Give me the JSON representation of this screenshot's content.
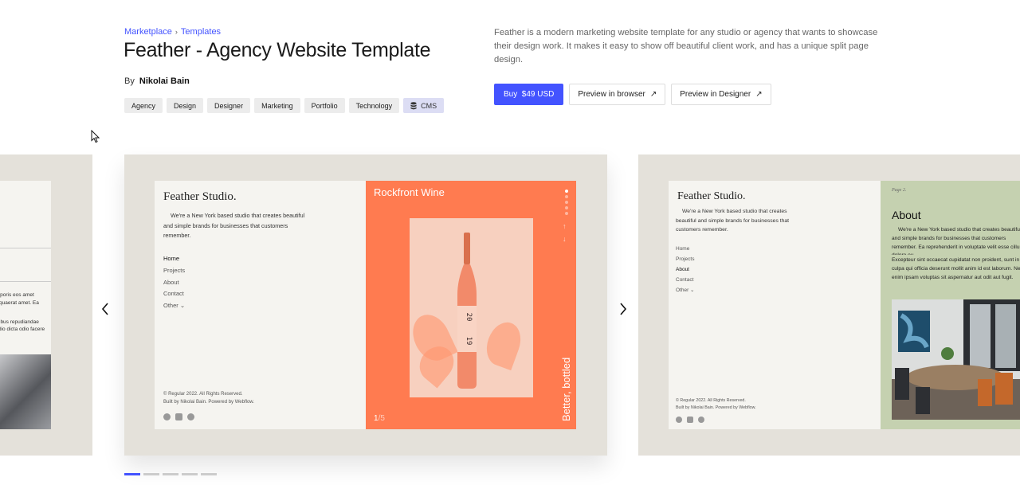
{
  "breadcrumb": {
    "items": [
      "Marketplace",
      "Templates"
    ],
    "separator": "›"
  },
  "product": {
    "title": "Feather - Agency Website Template",
    "by_label": "By",
    "author": "Nikolai Bain",
    "description": "Feather is a modern marketing website template for any studio or agency that wants to showcase their design work. It makes it easy to show off beautiful client work, and has a unique split page design.",
    "tags": [
      "Agency",
      "Design",
      "Designer",
      "Marketing",
      "Portfolio",
      "Technology"
    ],
    "cms_tag": "CMS"
  },
  "actions": {
    "buy": "Buy  $49 USD",
    "preview_browser": "Preview in browser",
    "preview_designer": "Preview in Designer",
    "external_icon": "↗"
  },
  "colors": {
    "accent": "#4353ff",
    "orange_panel": "#ff7b50",
    "green_panel": "#c5d1b0"
  },
  "gallery": {
    "prev_icon": "‹",
    "next_icon": "›",
    "slide_count": 5,
    "active_slide": 1,
    "left_card": {
      "lines": [
        "rporis eos amet",
        "quaerat amet. Ea",
        "ibus repudiandae",
        "dio dicta odio facere"
      ]
    },
    "main_card": {
      "brand": "Feather Studio.",
      "intro": "We're a New York based studio that creates beautiful and simple brands for businesses that customers remember.",
      "nav": [
        "Home",
        "Projects",
        "About",
        "Contact",
        "Other ⌄"
      ],
      "footer_line1": "© Regular 2022. All Rights Reserved.",
      "footer_line2": "Built by Nikolai Bain. Powered by Webflow.",
      "project_name": "Rockfront Wine",
      "project_tagline": "Better, bottled",
      "counter_current": "1",
      "counter_total": "/5"
    },
    "right_card": {
      "brand": "Feather Studio.",
      "intro": "We're a New York based studio that creates beautiful and simple brands for businesses that customers remember.",
      "nav": [
        "Home",
        "Projects",
        "About",
        "Contact",
        "Other ⌄"
      ],
      "footer_line1": "© Regular 2022. All Rights Reserved.",
      "footer_line2": "Built by Nikolai Bain. Powered by Webflow.",
      "page_label": "Page 2.",
      "heading": "About",
      "para1": "We're a New York based studio that creates beautiful and simple brands for businesses that customers remember. Ea reprehenderit in voluptate velit esse cillum dolore eu",
      "para2": "Excepteur sint occaecat cupidatat non proident, sunt in culpa qui officia deserunt mollit anim id est laborum. Nemo enim ipsam voluptas sit aspernatur aut odit aut fugit."
    }
  }
}
